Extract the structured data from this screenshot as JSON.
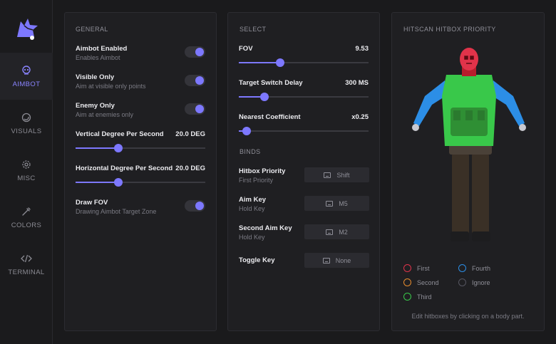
{
  "sidebar": {
    "items": [
      {
        "label": "AIMBOT",
        "icon": "skull-icon",
        "active": true
      },
      {
        "label": "VISUALS",
        "icon": "eye-icon"
      },
      {
        "label": "MISC",
        "icon": "gear-icon"
      },
      {
        "label": "COLORS",
        "icon": "eyedropper-icon"
      },
      {
        "label": "TERMINAL",
        "icon": "code-icon"
      }
    ]
  },
  "colors": {
    "accent": "#7d78ff",
    "first": "#e0334a",
    "second": "#e58b2e",
    "third": "#39c84a",
    "fourth": "#2c8ee6",
    "ignore": "#555560"
  },
  "general": {
    "title": "GENERAL",
    "aimbot_enabled": {
      "label": "Aimbot Enabled",
      "sub": "Enables Aimbot",
      "on": true
    },
    "visible_only": {
      "label": "Visible Only",
      "sub": "Aim at visible only points",
      "on": true
    },
    "enemy_only": {
      "label": "Enemy Only",
      "sub": "Aim at enemies only",
      "on": true
    },
    "vertical": {
      "label": "Vertical Degree Per Second",
      "value": "20.0 DEG",
      "fraction": 0.33
    },
    "horizontal": {
      "label": "Horizontal Degree Per Second",
      "value": "20.0 DEG",
      "fraction": 0.33
    },
    "draw_fov": {
      "label": "Draw FOV",
      "sub": "Drawing Aimbot Target Zone",
      "on": true
    }
  },
  "select": {
    "title": "SELECT",
    "fov": {
      "label": "FOV",
      "value": "9.53",
      "fraction": 0.32
    },
    "switch_delay": {
      "label": "Target Switch Delay",
      "value": "300 MS",
      "fraction": 0.2
    },
    "nearest": {
      "label": "Nearest Coefficient",
      "value": "x0.25",
      "fraction": 0.06
    }
  },
  "binds": {
    "title": "BINDS",
    "hitbox_priority": {
      "label": "Hitbox Priority",
      "sub": "First Priority",
      "key": "Shift"
    },
    "aim_key": {
      "label": "Aim Key",
      "sub": "Hold Key",
      "key": "M5"
    },
    "second_aim_key": {
      "label": "Second Aim Key",
      "sub": "Hold Key",
      "key": "M2"
    },
    "toggle_key": {
      "label": "Toggle Key",
      "key": "None"
    }
  },
  "hitscan": {
    "title": "HITSCAN HITBOX PRIORITY",
    "legend": {
      "first": "First",
      "second": "Second",
      "third": "Third",
      "fourth": "Fourth",
      "ignore": "Ignore"
    },
    "hint": "Edit hitboxes by clicking on a body part."
  }
}
